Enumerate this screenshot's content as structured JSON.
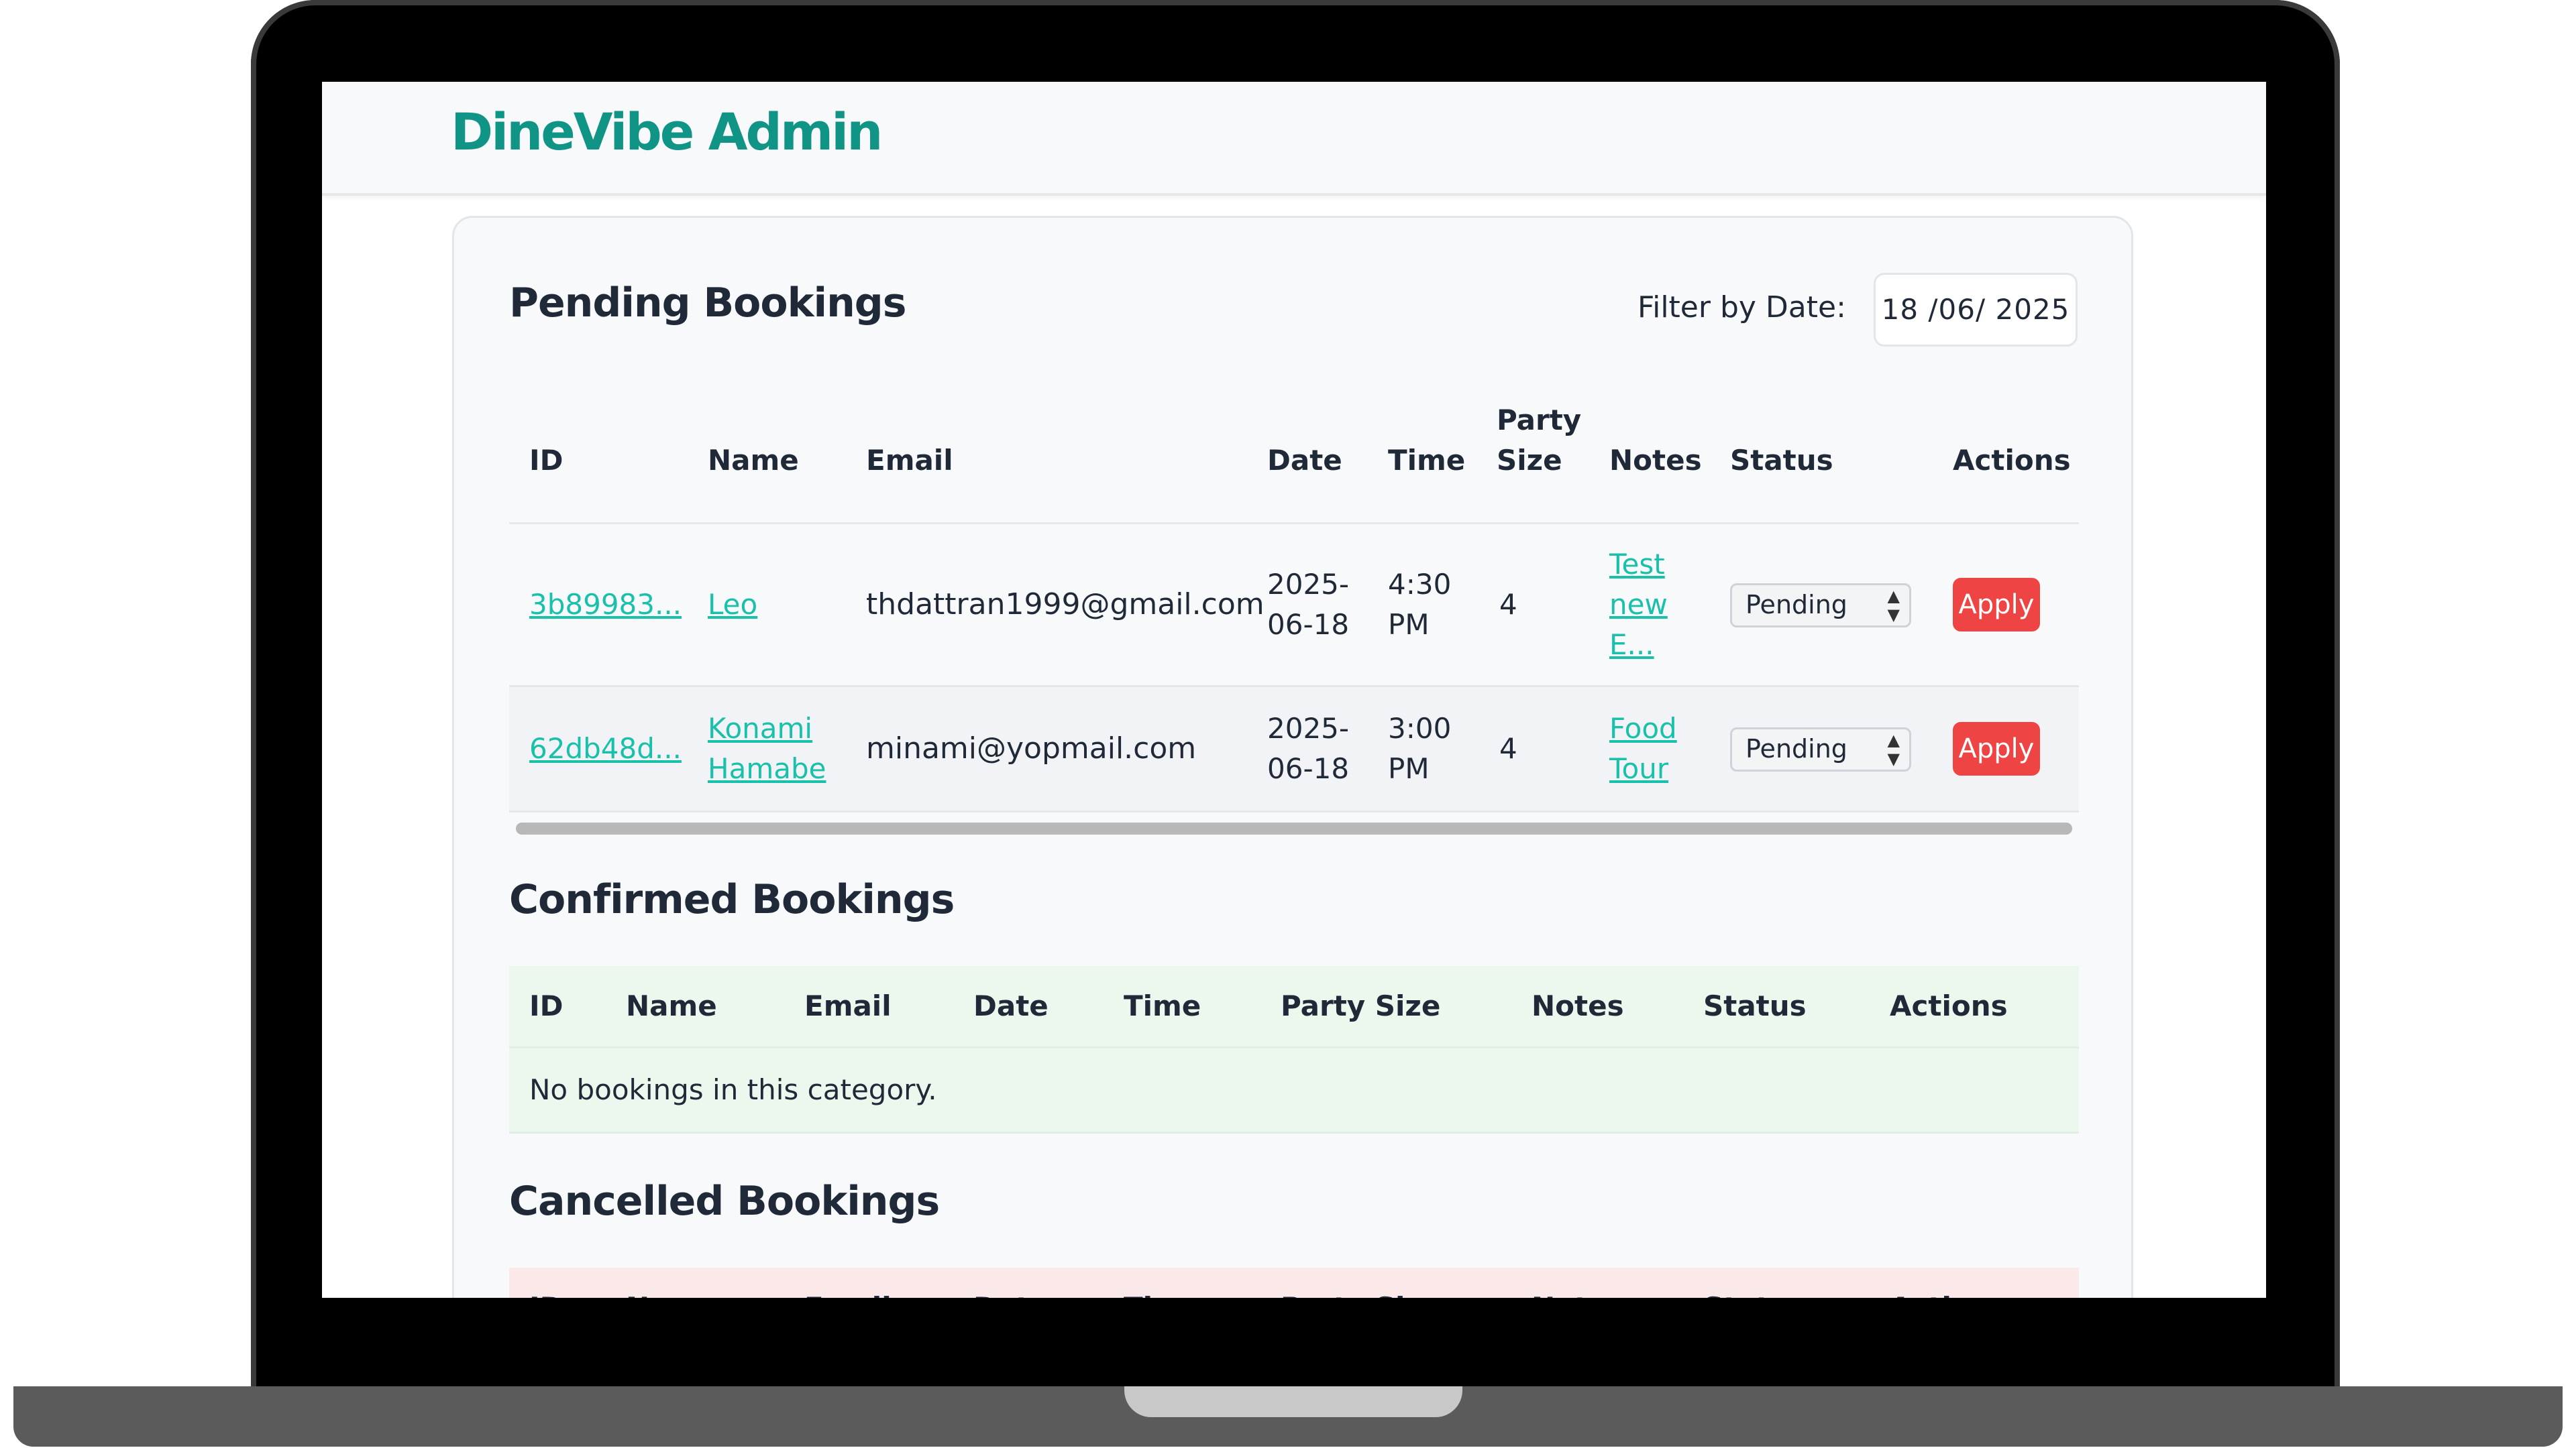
{
  "app": {
    "brand": "DineVibe Admin"
  },
  "pending": {
    "title": "Pending Bookings",
    "filter_label": "Filter by Date:",
    "filter_value": "18 /06/ 2025",
    "headers": {
      "id": "ID",
      "name": "Name",
      "email": "Email",
      "date": "Date",
      "time": "Time",
      "party_size_1": "Party",
      "party_size_2": "Size",
      "notes": "Notes",
      "status": "Status",
      "actions": "Actions"
    },
    "rows": [
      {
        "id": "3b89983...",
        "name_1": "Leo",
        "name_2": "",
        "email": "thdattran1999@gmail.com",
        "date_1": "2025-",
        "date_2": "06-18",
        "time_1": "4:30",
        "time_2": "PM",
        "party_size": "4",
        "notes_1": "Test",
        "notes_2": "new",
        "notes_3": "E...",
        "status": "Pending",
        "action": "Apply"
      },
      {
        "id": "62db48d...",
        "name_1": "Konami",
        "name_2": "Hamabe",
        "email": "minami@yopmail.com",
        "date_1": "2025-",
        "date_2": "06-18",
        "time_1": "3:00",
        "time_2": "PM",
        "party_size": "4",
        "notes_1": "Food",
        "notes_2": "Tour",
        "notes_3": "",
        "status": "Pending",
        "action": "Apply"
      }
    ]
  },
  "confirmed": {
    "title": "Confirmed Bookings",
    "headers": {
      "id": "ID",
      "name": "Name",
      "email": "Email",
      "date": "Date",
      "time": "Time",
      "party_size": "Party Size",
      "notes": "Notes",
      "status": "Status",
      "actions": "Actions"
    },
    "empty": "No bookings in this category."
  },
  "cancelled": {
    "title": "Cancelled Bookings",
    "headers": {
      "id": "ID",
      "name": "Name",
      "email": "Email",
      "date": "Date",
      "time": "Time",
      "party_size": "Party Size",
      "notes": "Notes",
      "status": "Status",
      "actions": "Actions"
    }
  },
  "colors": {
    "brand": "#0f9486",
    "link": "#19c0aa",
    "danger": "#ef4444",
    "confirmed_bg": "#ecf7ee",
    "cancelled_bg": "#fbe9ea"
  }
}
